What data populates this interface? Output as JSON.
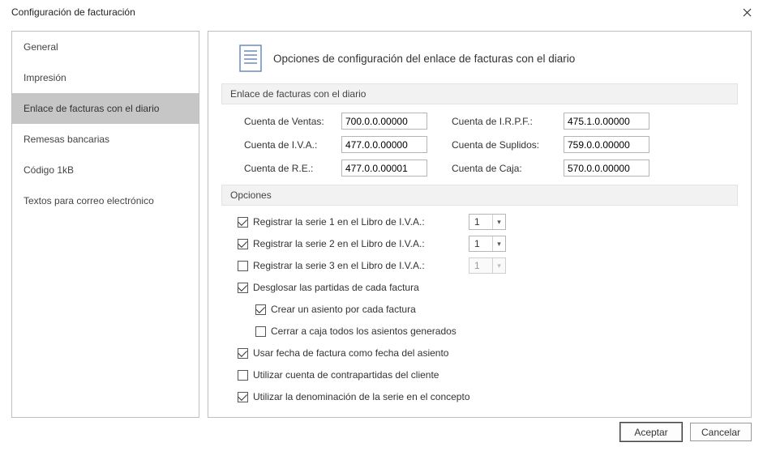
{
  "window": {
    "title": "Configuración de facturación"
  },
  "sidebar": {
    "items": [
      {
        "label": "General"
      },
      {
        "label": "Impresión"
      },
      {
        "label": "Enlace de facturas con el diario"
      },
      {
        "label": "Remesas bancarias"
      },
      {
        "label": "Código 1kB"
      },
      {
        "label": "Textos para correo electrónico"
      }
    ],
    "selected_index": 2
  },
  "content": {
    "header": "Opciones de configuración del enlace de facturas con el diario",
    "section_accounts": {
      "title": "Enlace de facturas con el diario",
      "left": [
        {
          "label": "Cuenta de Ventas:",
          "value": "700.0.0.00000"
        },
        {
          "label": "Cuenta de I.V.A.:",
          "value": "477.0.0.00000"
        },
        {
          "label": "Cuenta de R.E.:",
          "value": "477.0.0.00001"
        }
      ],
      "right": [
        {
          "label": "Cuenta de I.R.P.F.:",
          "value": "475.1.0.00000"
        },
        {
          "label": "Cuenta de Suplidos:",
          "value": "759.0.0.00000"
        },
        {
          "label": "Cuenta de Caja:",
          "value": "570.0.0.00000"
        }
      ]
    },
    "section_options": {
      "title": "Opciones",
      "serie1": {
        "label": "Registrar la serie 1 en el Libro de I.V.A.:",
        "checked": true,
        "select": "1",
        "select_enabled": true
      },
      "serie2": {
        "label": "Registrar la serie 2 en el Libro de I.V.A.:",
        "checked": true,
        "select": "1",
        "select_enabled": true
      },
      "serie3": {
        "label": "Registrar la serie 3 en el Libro de I.V.A.:",
        "checked": false,
        "select": "1",
        "select_enabled": false
      },
      "desglosar": {
        "label": "Desglosar las partidas de cada factura",
        "checked": true
      },
      "crear_asiento": {
        "label": "Crear un asiento por cada  factura",
        "checked": true
      },
      "cerrar_caja": {
        "label": "Cerrar a caja todos los asientos generados",
        "checked": false
      },
      "usar_fecha": {
        "label": "Usar fecha de factura como fecha del asiento",
        "checked": true
      },
      "contrapartidas": {
        "label": "Utilizar cuenta de contrapartidas del cliente",
        "checked": false
      },
      "denominacion": {
        "label": "Utilizar la denominación de la serie en el concepto",
        "checked": true
      }
    }
  },
  "buttons": {
    "ok": "Aceptar",
    "cancel": "Cancelar"
  }
}
